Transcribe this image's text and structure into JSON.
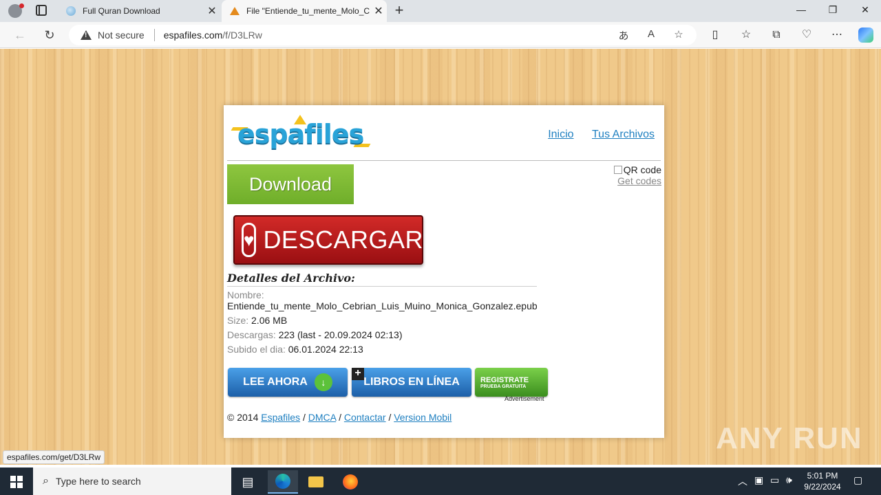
{
  "browser": {
    "tabs": [
      {
        "title": "Full Quran Download"
      },
      {
        "title": "File \"Entiende_tu_mente_Molo_C"
      }
    ],
    "address": {
      "security_label": "Not secure",
      "url_host": "espafiles.com",
      "url_path": "/f/D3LRw"
    },
    "status_url": "espafiles.com/get/D3LRw"
  },
  "page": {
    "logo_text": "espafiles",
    "nav": [
      {
        "label": "Inicio"
      },
      {
        "label": "Tus Archivos"
      }
    ],
    "download_label": "Download",
    "qr_alt": "QR code",
    "get_codes": "Get codes",
    "descargar_label": "DESCARGAR",
    "details_title": "Detalles del Archivo:",
    "details": {
      "name_label": "Nombre:",
      "name_value": "Entiende_tu_mente_Molo_Cebrian_Luis_Muino_Monica_Gonzalez.epub",
      "size_label": "Size:",
      "size_value": "2.06 MB",
      "downloads_label": "Descargas:",
      "downloads_value": "223 (last - 20.09.2024 02:13)",
      "uploaded_label": "Subido el dia:",
      "uploaded_value": "06.01.2024 22:13"
    },
    "ads": {
      "lee_ahora": "LEE AHORA",
      "libros": "LIBROS EN LÍNEA",
      "registrate": "REGISTRATE",
      "prueba": "PRUEBA GRATUITA",
      "caption": "Advertisement"
    },
    "footer": {
      "copyright": "© 2014",
      "links": [
        "Espafiles",
        "DMCA",
        "Contactar",
        "Version Mobil"
      ]
    }
  },
  "watermark": "ANY RUN",
  "taskbar": {
    "search_placeholder": "Type here to search",
    "time": "5:01 PM",
    "date": "9/22/2024"
  },
  "colors": {
    "link": "#1e7fc0",
    "download_green": "#8ec63f",
    "descargar_red": "#c4201f",
    "logo_blue": "#29a3d8"
  }
}
